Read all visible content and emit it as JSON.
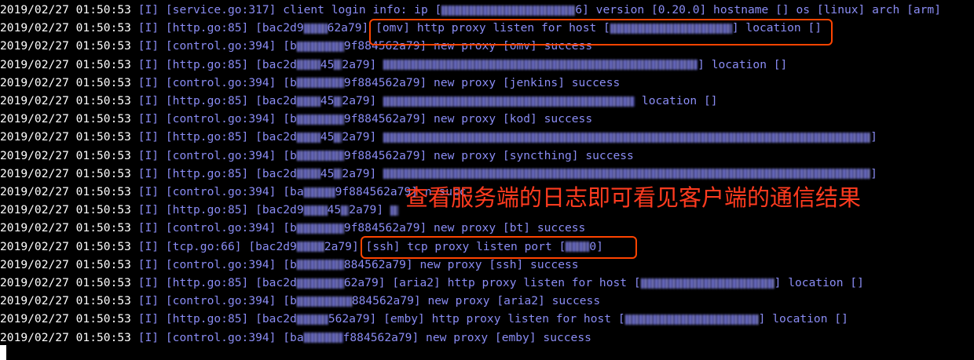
{
  "terminal": {
    "lines": [
      {
        "ts": "2019/02/27 01:50:53",
        "a": "[I] [service.go:317] client login info: ip [",
        "b": "6] version [0.20.0] hostname [] os [linux] arch [arm]"
      },
      {
        "ts": "2019/02/27 01:50:53",
        "a": "[I] [http.go:85] [bac2d9",
        "b": "62a79] [omv] http proxy listen for host [",
        "c": "] location []"
      },
      {
        "ts": "2019/02/27 01:50:53",
        "a": "[I] [control.go:394] [b",
        "b": "9f884562a79] new proxy [omv] success"
      },
      {
        "ts": "2019/02/27 01:50:53",
        "a": "[I] [http.go:85] [bac2d",
        "b": "45",
        "c": "2a79] ",
        "d": "] location []"
      },
      {
        "ts": "2019/02/27 01:50:53",
        "a": "[I] [control.go:394] [b",
        "b": "9f884562a79] new proxy [jenkins] success"
      },
      {
        "ts": "2019/02/27 01:50:53",
        "a": "[I] [http.go:85] [bac2d",
        "b": "45",
        "c": "2a79] ",
        "d": " location []"
      },
      {
        "ts": "2019/02/27 01:50:53",
        "a": "[I] [control.go:394] [b",
        "b": "9f884562a79] new proxy [kod] success"
      },
      {
        "ts": "2019/02/27 01:50:53",
        "a": "[I] [http.go:85] [bac2d",
        "b": "45",
        "c": "2a79] ",
        "d": "]"
      },
      {
        "ts": "2019/02/27 01:50:53",
        "a": "[I] [control.go:394] [b",
        "b": "9f884562a79] new proxy [syncthing] success"
      },
      {
        "ts": "2019/02/27 01:50:53",
        "a": "[I] [http.go:85] [bac2d",
        "b": "45",
        "c": "2a79] ",
        "d": "]"
      },
      {
        "ts": "2019/02/27 01:50:53",
        "a": "[I] [control.go:394] [ba",
        "b": "9f884562a79] n",
        "c": " succ"
      },
      {
        "ts": "2019/02/27 01:50:53",
        "a": "[I] [http.go:85] [bac2d9",
        "b": "45",
        "c": "2a79] ",
        "d": ""
      },
      {
        "ts": "2019/02/27 01:50:53",
        "a": "[I] [control.go:394] [b",
        "b": "9f884562a79] new proxy [bt] success"
      },
      {
        "ts": "2019/02/27 01:50:53",
        "a": "[I] [tcp.go:66] [bac2d9",
        "b": "2a79] [ssh] tcp proxy listen port [",
        "c": "0]"
      },
      {
        "ts": "2019/02/27 01:50:53",
        "a": "[I] [control.go:394] [b",
        "b": "884562a79] new proxy [ssh] success"
      },
      {
        "ts": "2019/02/27 01:50:53",
        "a": "[I] [http.go:85] [bac2d",
        "b": "62a79] [aria2] http proxy listen for host [",
        "c": "] location []"
      },
      {
        "ts": "2019/02/27 01:50:53",
        "a": "[I] [control.go:394] [b",
        "b": "884562a79] new proxy [aria2] success"
      },
      {
        "ts": "2019/02/27 01:50:53",
        "a": "[I] [http.go:85] [bac2d",
        "b": "562a79] [emby] http proxy listen for host [",
        "c": "] location []"
      },
      {
        "ts": "2019/02/27 01:50:53",
        "a": "[I] [control.go:394] [ba",
        "b": "f884562a79] new proxy [emby] success"
      }
    ]
  },
  "annotation": {
    "text": "查看服务端的日志即可看见客户端的通信结果",
    "color": "#ff3b1f"
  },
  "colors": {
    "background": "#000000",
    "timestamp": "#ffffff",
    "log_text": "#8a8cf4",
    "highlight_box": "#ff4400"
  }
}
